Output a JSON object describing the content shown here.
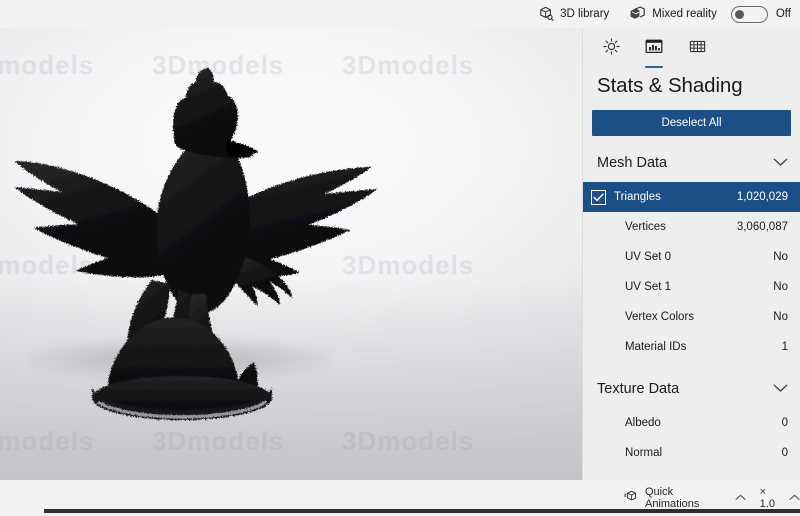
{
  "topbar": {
    "library_label": "3D library",
    "library_icon": "cube-search-icon",
    "mixed_reality_label": "Mixed reality",
    "mixed_reality_icon": "mixed-reality-icon",
    "toggle_state": "Off",
    "toggle_on": false
  },
  "panel": {
    "tabs": [
      {
        "name": "lighting",
        "icon": "sun-icon",
        "selected": false
      },
      {
        "name": "stats-shading",
        "icon": "chart-stats-icon",
        "selected": true
      },
      {
        "name": "materials",
        "icon": "grid-icon",
        "selected": false
      }
    ],
    "title": "Stats & Shading",
    "deselect_label": "Deselect All",
    "accent_color": "#1d4f87",
    "sections": [
      {
        "title": "Mesh Data",
        "expanded": true,
        "chevron": "chevron-down-icon",
        "rows": [
          {
            "label": "Triangles",
            "value": "1,020,029",
            "selected": true,
            "checked": true
          },
          {
            "label": "Vertices",
            "value": "3,060,087",
            "selected": false,
            "checked": false
          },
          {
            "label": "UV Set 0",
            "value": "No",
            "selected": false,
            "checked": false
          },
          {
            "label": "UV Set 1",
            "value": "No",
            "selected": false,
            "checked": false
          },
          {
            "label": "Vertex Colors",
            "value": "No",
            "selected": false,
            "checked": false
          },
          {
            "label": "Material IDs",
            "value": "1",
            "selected": false,
            "checked": false
          }
        ]
      },
      {
        "title": "Texture Data",
        "expanded": true,
        "chevron": "chevron-down-icon",
        "rows": [
          {
            "label": "Albedo",
            "value": "0",
            "selected": false,
            "checked": false
          },
          {
            "label": "Normal",
            "value": "0",
            "selected": false,
            "checked": false
          }
        ]
      }
    ]
  },
  "bottombar": {
    "quick_animations_label": "Quick Animations",
    "quick_animations_icon": "animation-cube-icon",
    "quick_animations_chevron": "chevron-up-icon",
    "speed_label": "× 1.0",
    "speed_chevron": "chevron-up-icon"
  },
  "viewport": {
    "model_name": "griffin-statue",
    "watermark_text": "3Dmodels",
    "background_color": "#eef0f1"
  }
}
